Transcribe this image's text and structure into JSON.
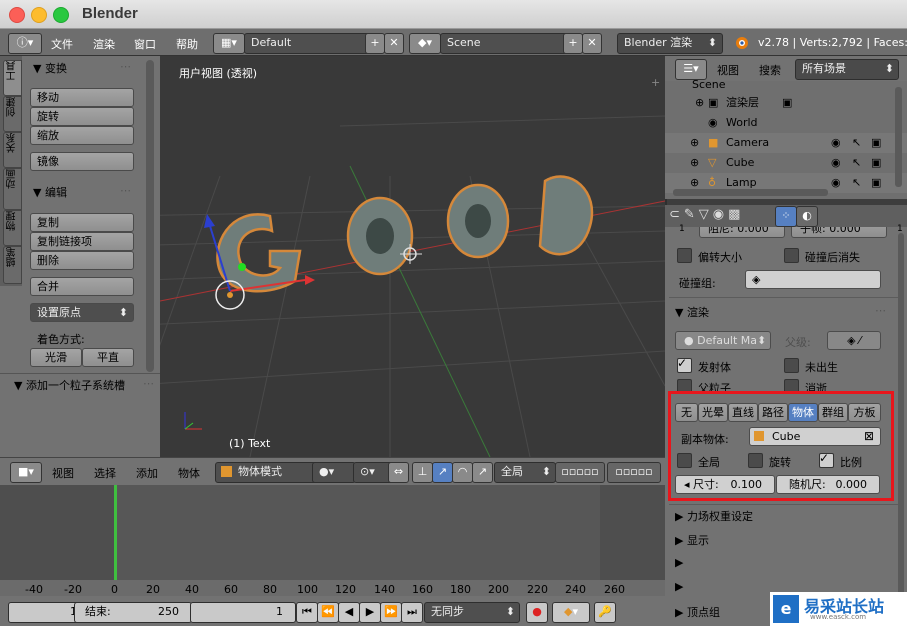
{
  "window": {
    "title": "Blender"
  },
  "infobar": {
    "menus": [
      "文件",
      "渲染",
      "窗口",
      "帮助"
    ],
    "screen_layout": "Default",
    "scene": "Scene",
    "engine": "Blender 渲染",
    "stats": "v2.78 | Verts:2,792 | Faces:1"
  },
  "toolshelf": {
    "tabs": [
      "工具",
      "创建",
      "关系",
      "动画",
      "物理",
      "蜡笔"
    ],
    "transform_header": "▼ 变换",
    "transform_buttons": [
      "移动",
      "旋转",
      "缩放",
      "镜像"
    ],
    "edit_header": "▼ 编辑",
    "edit_buttons": [
      "复制",
      "复制链接项",
      "删除",
      "合并"
    ],
    "set_origin": "设置原点",
    "shading_label": "着色方式:",
    "shading_smooth": "光滑",
    "shading_flat": "平直",
    "particle_header": "▼ 添加一个粒子系统槽"
  },
  "viewport": {
    "view_label": "用户视图 (透视)",
    "object_label": "(1) Text",
    "text_object": "GOOD"
  },
  "view3d_header": {
    "menus": [
      "视图",
      "选择",
      "添加",
      "物体"
    ],
    "mode": "物体模式",
    "pivot": "全局"
  },
  "timeline": {
    "ticks": [
      "-40",
      "-20",
      "0",
      "20",
      "40",
      "60",
      "80",
      "100",
      "120",
      "140",
      "160",
      "180",
      "200",
      "220",
      "240",
      "260"
    ],
    "current_frame": 1,
    "start_frame": "1",
    "end_label": "结束:",
    "end_frame": "250",
    "frame": "1",
    "sync": "无同步"
  },
  "outliner": {
    "menus": [
      "视图",
      "搜索"
    ],
    "filter": "所有场景",
    "rows": [
      "Scene",
      "渲染层",
      "World",
      "Camera",
      "Cube",
      "Lamp"
    ]
  },
  "properties": {
    "partial_top": [
      "阻尼:",
      "0.000",
      "1",
      "子帧:",
      "0.000",
      "1"
    ],
    "invert_size": "偏转大小",
    "die_on_hit": "碰撞后消失",
    "collision_group": "碰撞组:",
    "render_header": "▼ 渲染",
    "material": "Default Ma",
    "parent_label": "父级:",
    "emitter": "发射体",
    "unborn": "未出生",
    "parents": "父粒子",
    "died": "消逝",
    "render_types": [
      "无",
      "光晕",
      "直线",
      "路径",
      "物体",
      "群组",
      "方板"
    ],
    "render_type_active": "物体",
    "dupli_object_label": "副本物体:",
    "dupli_object": "Cube",
    "global": "全局",
    "rotation": "旋转",
    "scale_check": "比例",
    "size_label": "尺寸:",
    "size_value": "0.100",
    "random_size_label": "随机尺:",
    "random_size_value": "0.000",
    "field_weights": "▶ 力场权重设定",
    "display": "▶ 显示",
    "vertex_groups": "▶ 顶点组"
  },
  "watermark": {
    "text": "易采站长站",
    "url": "www.easck.com"
  },
  "colors": {
    "accent_blue": "#5680c2",
    "highlight_red": "#e8161c",
    "frame_green": "#3fbf3f"
  }
}
